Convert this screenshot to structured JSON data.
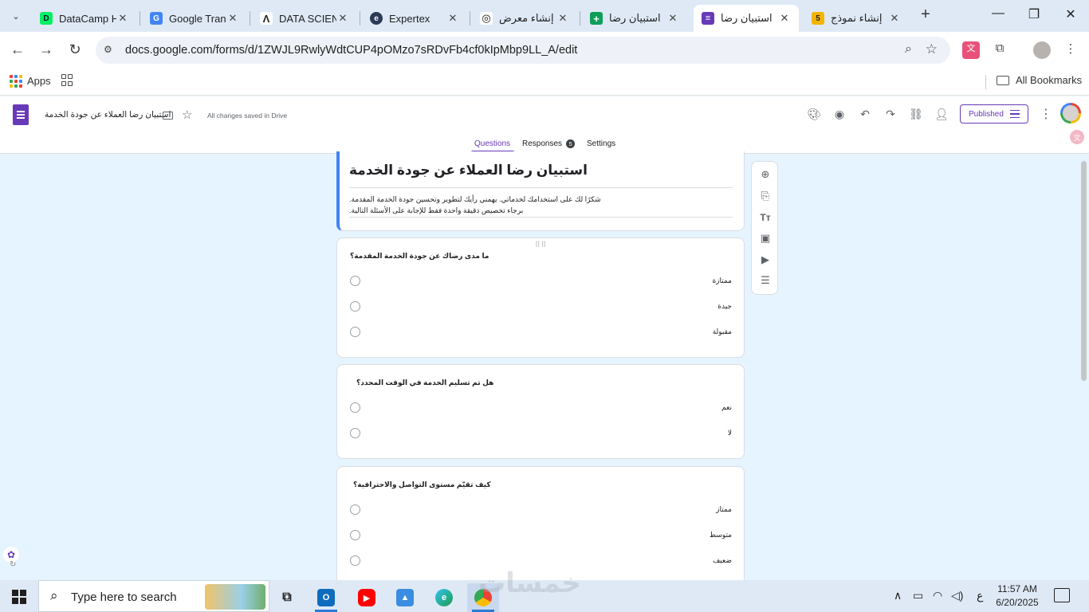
{
  "browser": {
    "tabs": [
      {
        "title": "DataCamp H",
        "favicon_color": "#03ef62",
        "favicon_glyph": "D"
      },
      {
        "title": "Google Trans",
        "favicon_color": "#4285f4",
        "favicon_glyph": "G"
      },
      {
        "title": "DATA SCIENC",
        "favicon_color": "#222222",
        "favicon_glyph": "Λ"
      },
      {
        "title": "Expertex",
        "favicon_color": "#2b3a55",
        "favicon_glyph": "e"
      },
      {
        "title": "إنشاء معرض",
        "favicon_color": "#111111",
        "favicon_glyph": "◎"
      },
      {
        "title": "استبيان رضا",
        "favicon_color": "#0f9d58",
        "favicon_glyph": "+"
      },
      {
        "title": "استبيان رضا",
        "favicon_color": "#673ab7",
        "favicon_glyph": "≡",
        "active": true
      },
      {
        "title": "إنشاء نموذج",
        "favicon_color": "#f4b400",
        "favicon_glyph": "5"
      }
    ],
    "url": "docs.google.com/forms/d/1ZWJL9RwlyWdtCUP4pOMzo7sRDvFb4cf0kIpMbp9LL_A/edit",
    "bookmarks": {
      "apps_label": "Apps",
      "all_bookmarks": "All Bookmarks"
    }
  },
  "forms_header": {
    "doc_title": "استبيان رضا العملاء عن جودة الخدمة",
    "saved_status": "All changes saved in Drive",
    "published_label": "Published",
    "tabs": {
      "questions": "Questions",
      "responses": "Responses",
      "responses_count": "5",
      "settings": "Settings"
    }
  },
  "form": {
    "title": "استبيان رضا العملاء عن جودة الخدمة",
    "description_line1": "شكرًا لك على استخدامك لخدماتي. يهمني رأيك لتطوير وتحسين جودة الخدمة المقدمة.",
    "description_line2": "برجاء تخصيص دقيقة واحدة فقط للإجابة على الأسئلة التالية.",
    "questions": [
      {
        "title": "ما مدى رضاك عن جودة الخدمة المقدمة؟",
        "options": [
          "ممتازة",
          "جيدة",
          "مقبولة"
        ]
      },
      {
        "title": "هل تم تسليم الخدمة في الوقت المحدد؟",
        "options": [
          "نعم",
          "لا"
        ]
      },
      {
        "title": "كيف تقيّم مستوى التواصل والاحترافية؟",
        "options": [
          "ممتاز",
          "متوسط",
          "ضعيف"
        ]
      }
    ]
  },
  "taskbar": {
    "search_placeholder": "Type here to search",
    "time": "11:57 AM",
    "date": "6/20/2025",
    "lang": "ع",
    "watermark": "خمسات"
  }
}
